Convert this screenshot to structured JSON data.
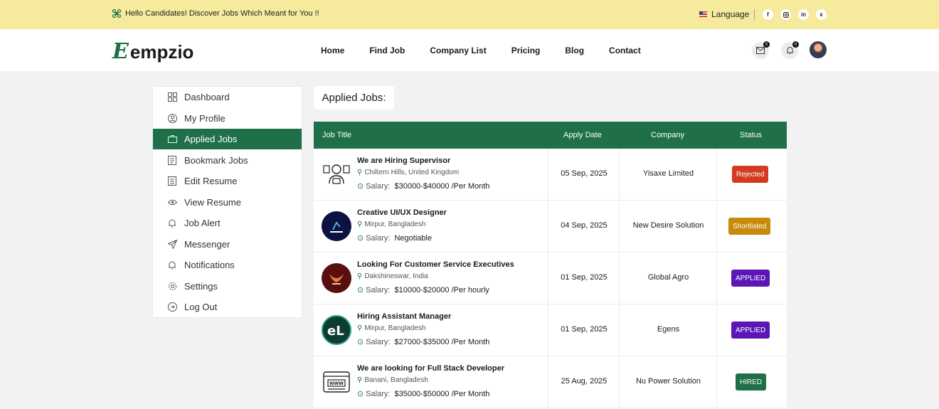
{
  "topbar": {
    "hello_text": "Hello Candidates! Discover Jobs Which Meant for You !!",
    "language_label": "Language",
    "social": [
      "f",
      "ig",
      "in",
      "x"
    ]
  },
  "header": {
    "logo_initial": "E",
    "logo_text": "empzio",
    "nav": [
      "Home",
      "Find Job",
      "Company List",
      "Pricing",
      "Blog",
      "Contact"
    ],
    "messages_count": "0",
    "notifications_count": "0"
  },
  "sidebar": {
    "items": [
      {
        "label": "Dashboard",
        "icon": "dashboard-icon"
      },
      {
        "label": "My Profile",
        "icon": "profile-icon"
      },
      {
        "label": "Applied Jobs",
        "icon": "briefcase-icon",
        "active": true
      },
      {
        "label": "Bookmark Jobs",
        "icon": "bookmark-icon"
      },
      {
        "label": "Edit Resume",
        "icon": "edit-icon"
      },
      {
        "label": "View Resume",
        "icon": "eye-icon"
      },
      {
        "label": "Job Alert",
        "icon": "alert-icon"
      },
      {
        "label": "Messenger",
        "icon": "send-icon"
      },
      {
        "label": "Notifications",
        "icon": "bell-icon"
      },
      {
        "label": "Settings",
        "icon": "gear-icon"
      },
      {
        "label": "Log Out",
        "icon": "logout-icon"
      }
    ]
  },
  "main": {
    "title": "Applied Jobs:",
    "columns": [
      "Job Title",
      "Apply Date",
      "Company",
      "Status"
    ],
    "salary_label": "Salary:",
    "rows": [
      {
        "title": "We are Hiring Supervisor",
        "location": "Chiltern Hills, United Kingdom",
        "salary": "$30000-$40000 /Per Month",
        "date": "05 Sep, 2025",
        "company": "Yisaxe Limited",
        "status": "Rejected",
        "status_color": "#d33a1f"
      },
      {
        "title": "Creative UI/UX Designer",
        "location": "Mirpur, Bangladesh",
        "salary": "Negotiable",
        "date": "04 Sep, 2025",
        "company": "New Desire Solution",
        "status": "Shortlisted",
        "status_color": "#c78a09"
      },
      {
        "title": "Looking For Customer Service Executives",
        "location": "Dakshineswar, India",
        "salary": "$10000-$20000 /Per hourly",
        "date": "01 Sep, 2025",
        "company": "Global Agro",
        "status": "APPLIED",
        "status_color": "#5b16b5"
      },
      {
        "title": "Hiring Assistant Manager",
        "location": "Mirpur, Bangladesh",
        "salary": "$27000-$35000 /Per Month",
        "date": "01 Sep, 2025",
        "company": "Egens",
        "status": "APPLIED",
        "status_color": "#5b16b5"
      },
      {
        "title": "We are looking for Full Stack Developer",
        "location": "Banani, Bangladesh",
        "salary": "$35000-$50000 /Per Month",
        "date": "25 Aug, 2025",
        "company": "Nu Power Solution",
        "status": "HIRED",
        "status_color": "#1f7048"
      }
    ]
  },
  "colors": {
    "primary": "#1f7048",
    "topbar": "#f6eb9d"
  }
}
